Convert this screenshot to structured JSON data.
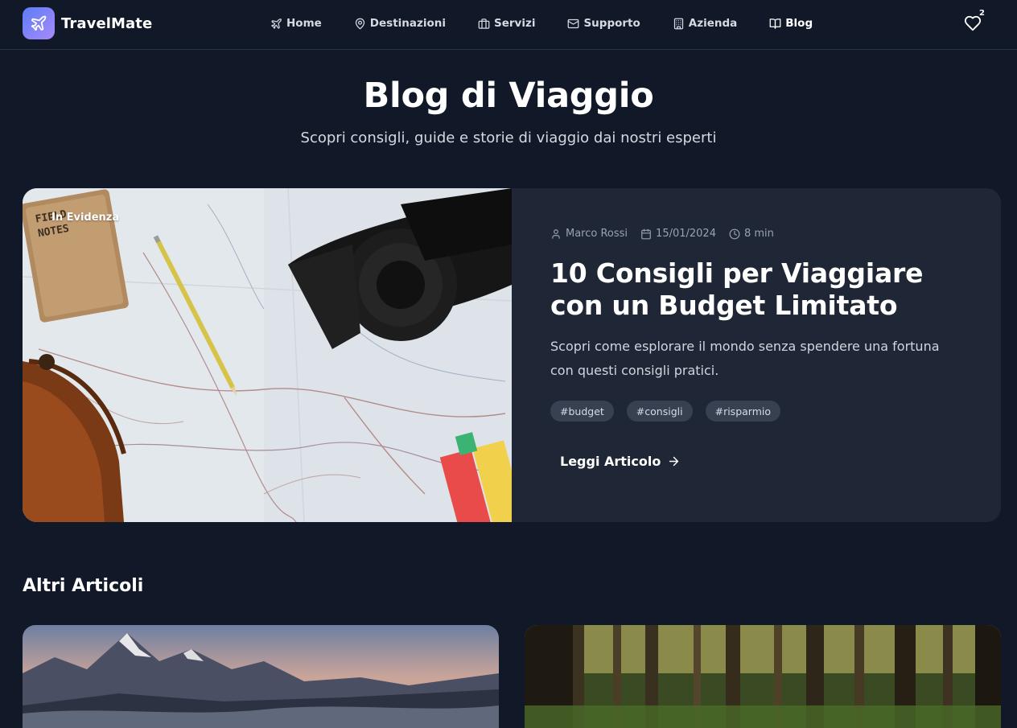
{
  "brand": {
    "name": "TravelMate",
    "accent_from": "#5b7cf6",
    "accent_to": "#a78bfa"
  },
  "nav": {
    "items": [
      {
        "label": "Home",
        "icon": "plane-icon"
      },
      {
        "label": "Destinazioni",
        "icon": "map-pin-icon"
      },
      {
        "label": "Servizi",
        "icon": "briefcase-icon"
      },
      {
        "label": "Supporto",
        "icon": "mail-icon"
      },
      {
        "label": "Azienda",
        "icon": "building-icon"
      },
      {
        "label": "Blog",
        "icon": "book-open-icon",
        "active": true
      }
    ],
    "favorites_count": "2"
  },
  "hero": {
    "title": "Blog di Viaggio",
    "subtitle": "Scopri consigli, guide e storie di viaggio dai nostri esperti"
  },
  "featured": {
    "badge": "In Evidenza",
    "author": "Marco Rossi",
    "date": "15/01/2024",
    "read_time": "8 min",
    "title": "10 Consigli per Viaggiare con un Budget Limitato",
    "excerpt": "Scopri come esplorare il mondo senza spendere una fortuna con questi consigli pratici.",
    "tags": [
      "#budget",
      "#consigli",
      "#risparmio"
    ],
    "cta": "Leggi Articolo"
  },
  "other": {
    "title": "Altri Articoli"
  },
  "colors": {
    "background": "#111827",
    "card": "#1f2736",
    "tag": "#374151"
  }
}
